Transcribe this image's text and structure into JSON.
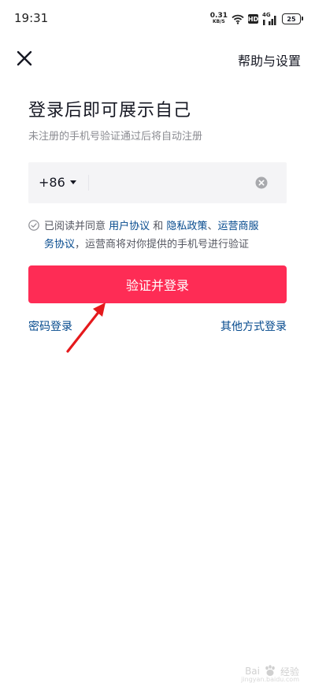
{
  "status_bar": {
    "time": "19:31",
    "net_speed": "0.31",
    "net_unit": "KB/S",
    "hd_label": "HD",
    "network_label": "4G",
    "battery": "25",
    "icons": [
      "wifi-icon",
      "hd-icon",
      "signal-4g-icon",
      "battery-icon"
    ]
  },
  "header": {
    "close_icon": "close-icon",
    "help_label": "帮助与设置"
  },
  "main": {
    "title": "登录后即可展示自己",
    "subtitle": "未注册的手机号验证通过后将自动注册",
    "phone": {
      "country_code": "+86",
      "value": "",
      "clear_icon": "clear-icon"
    },
    "agreement": {
      "prefix": "已阅读并同意 ",
      "user_agreement": "用户协议",
      "and": " 和 ",
      "privacy_policy": "隐私政策",
      "separator": "、",
      "carrier_part1": "运营商服",
      "carrier_part2": "务协议",
      "suffix": "，运营商将对你提供的手机号进行验证",
      "checked": false
    },
    "submit_label": "验证并登录",
    "password_login": "密码登录",
    "other_login": "其他方式登录"
  },
  "annotation": {
    "arrow_color": "#e5191c"
  },
  "watermark": {
    "text": "Bai",
    "text2": "经验",
    "sub": "jingyan.baidu.com"
  },
  "colors": {
    "accent": "#fe2c55",
    "link": "#04498d",
    "muted": "#8a8b91",
    "input_bg": "#f4f4f6"
  }
}
